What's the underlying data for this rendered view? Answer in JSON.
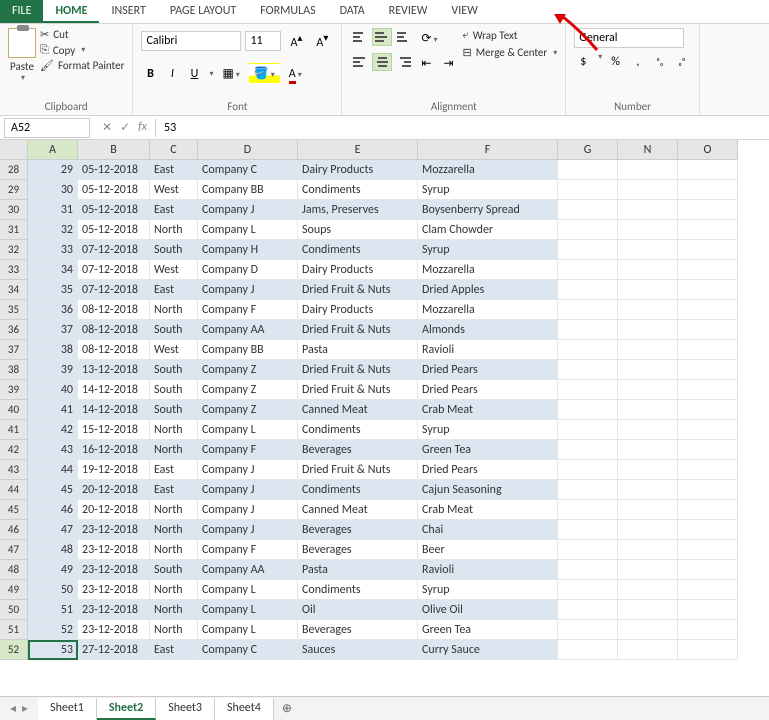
{
  "tabs": {
    "file": "FILE",
    "home": "HOME",
    "insert": "INSERT",
    "page_layout": "PAGE LAYOUT",
    "formulas": "FORMULAS",
    "data": "DATA",
    "review": "REVIEW",
    "view": "VIEW"
  },
  "ribbon": {
    "clipboard": {
      "paste": "Paste",
      "cut": "Cut",
      "copy": "Copy",
      "format_painter": "Format Painter",
      "label": "Clipboard"
    },
    "font": {
      "name": "Calibri",
      "size": "11",
      "bold": "B",
      "italic": "I",
      "underline": "U",
      "grow": "A▴",
      "shrink": "A▾",
      "label": "Font"
    },
    "alignment": {
      "wrap": "Wrap Text",
      "merge": "Merge & Center",
      "label": "Alignment"
    },
    "number": {
      "format": "General",
      "currency": "$",
      "percent": "%",
      "comma": ",",
      "inc": ".0→.00",
      "dec": ".00→.0",
      "label": "Number"
    }
  },
  "name_box": "A52",
  "formula_value": "53",
  "columns": [
    "A",
    "B",
    "C",
    "D",
    "E",
    "F",
    "G",
    "N",
    "O"
  ],
  "row_start": 28,
  "rows": [
    {
      "n": 29,
      "date": "05-12-2018",
      "region": "East",
      "company": "Company C",
      "category": "Dairy Products",
      "product": "Mozzarella"
    },
    {
      "n": 30,
      "date": "05-12-2018",
      "region": "West",
      "company": "Company BB",
      "category": "Condiments",
      "product": "Syrup"
    },
    {
      "n": 31,
      "date": "05-12-2018",
      "region": "East",
      "company": "Company J",
      "category": "Jams, Preserves",
      "product": "Boysenberry Spread"
    },
    {
      "n": 32,
      "date": "05-12-2018",
      "region": "North",
      "company": "Company L",
      "category": "Soups",
      "product": "Clam Chowder"
    },
    {
      "n": 33,
      "date": "07-12-2018",
      "region": "South",
      "company": "Company H",
      "category": "Condiments",
      "product": "Syrup"
    },
    {
      "n": 34,
      "date": "07-12-2018",
      "region": "West",
      "company": "Company D",
      "category": "Dairy Products",
      "product": "Mozzarella"
    },
    {
      "n": 35,
      "date": "07-12-2018",
      "region": "East",
      "company": "Company J",
      "category": "Dried Fruit & Nuts",
      "product": "Dried Apples"
    },
    {
      "n": 36,
      "date": "08-12-2018",
      "region": "North",
      "company": "Company F",
      "category": "Dairy Products",
      "product": "Mozzarella"
    },
    {
      "n": 37,
      "date": "08-12-2018",
      "region": "South",
      "company": "Company AA",
      "category": "Dried Fruit & Nuts",
      "product": "Almonds"
    },
    {
      "n": 38,
      "date": "08-12-2018",
      "region": "West",
      "company": "Company BB",
      "category": "Pasta",
      "product": "Ravioli"
    },
    {
      "n": 39,
      "date": "13-12-2018",
      "region": "South",
      "company": "Company Z",
      "category": "Dried Fruit & Nuts",
      "product": "Dried Pears"
    },
    {
      "n": 40,
      "date": "14-12-2018",
      "region": "South",
      "company": "Company Z",
      "category": "Dried Fruit & Nuts",
      "product": "Dried Pears"
    },
    {
      "n": 41,
      "date": "14-12-2018",
      "region": "South",
      "company": "Company Z",
      "category": "Canned Meat",
      "product": "Crab Meat"
    },
    {
      "n": 42,
      "date": "15-12-2018",
      "region": "North",
      "company": "Company L",
      "category": "Condiments",
      "product": "Syrup"
    },
    {
      "n": 43,
      "date": "16-12-2018",
      "region": "North",
      "company": "Company F",
      "category": "Beverages",
      "product": "Green Tea"
    },
    {
      "n": 44,
      "date": "19-12-2018",
      "region": "East",
      "company": "Company J",
      "category": "Dried Fruit & Nuts",
      "product": "Dried Pears"
    },
    {
      "n": 45,
      "date": "20-12-2018",
      "region": "East",
      "company": "Company J",
      "category": "Condiments",
      "product": "Cajun Seasoning"
    },
    {
      "n": 46,
      "date": "20-12-2018",
      "region": "North",
      "company": "Company J",
      "category": "Canned Meat",
      "product": "Crab Meat"
    },
    {
      "n": 47,
      "date": "23-12-2018",
      "region": "North",
      "company": "Company J",
      "category": "Beverages",
      "product": "Chai"
    },
    {
      "n": 48,
      "date": "23-12-2018",
      "region": "North",
      "company": "Company F",
      "category": "Beverages",
      "product": "Beer"
    },
    {
      "n": 49,
      "date": "23-12-2018",
      "region": "South",
      "company": "Company AA",
      "category": "Pasta",
      "product": "Ravioli"
    },
    {
      "n": 50,
      "date": "23-12-2018",
      "region": "North",
      "company": "Company L",
      "category": "Condiments",
      "product": "Syrup"
    },
    {
      "n": 51,
      "date": "23-12-2018",
      "region": "North",
      "company": "Company L",
      "category": "Oil",
      "product": "Olive Oil"
    },
    {
      "n": 52,
      "date": "23-12-2018",
      "region": "North",
      "company": "Company L",
      "category": "Beverages",
      "product": "Green Tea"
    },
    {
      "n": 53,
      "date": "27-12-2018",
      "region": "East",
      "company": "Company C",
      "category": "Sauces",
      "product": "Curry Sauce"
    }
  ],
  "sheets": [
    "Sheet1",
    "Sheet2",
    "Sheet3",
    "Sheet4"
  ],
  "active_sheet": 1,
  "active_cell_row_index": 24,
  "colors": {
    "accent": "#217346",
    "alt_row": "#dce6f1"
  }
}
